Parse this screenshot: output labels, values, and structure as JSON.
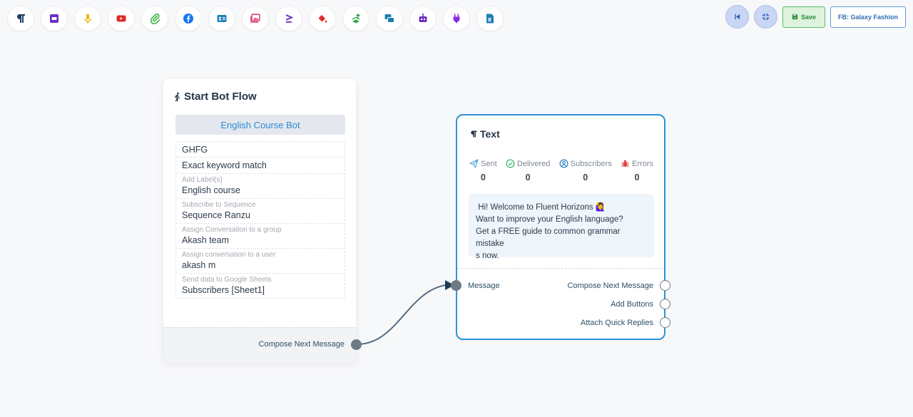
{
  "toolbar": {
    "tools": [
      {
        "icon": "paragraph-icon",
        "color": "#1f3d63"
      },
      {
        "icon": "card-icon",
        "color": "#6a2fc0"
      },
      {
        "icon": "microphone-icon",
        "color": "#f0b90b"
      },
      {
        "icon": "youtube-icon",
        "color": "#e02a2a"
      },
      {
        "icon": "paperclip-icon",
        "color": "#49b449"
      },
      {
        "icon": "facebook-icon",
        "color": "#1877f2"
      },
      {
        "icon": "contact-card-icon",
        "color": "#1b7fb5"
      },
      {
        "icon": "gallery-icon",
        "color": "#d6336c"
      },
      {
        "icon": "greater-equal-icon",
        "color": "#6a2fc0"
      },
      {
        "icon": "paint-bucket-icon",
        "color": "#e02a2a"
      },
      {
        "icon": "stack-icon",
        "color": "#2ca344"
      },
      {
        "icon": "messages-icon",
        "color": "#1b7fb5"
      },
      {
        "icon": "robot-icon",
        "color": "#6a2fc0"
      },
      {
        "icon": "plug-icon",
        "color": "#8a2be2"
      },
      {
        "icon": "excel-file-icon",
        "color": "#1b7fb5"
      }
    ],
    "save_label": "Save",
    "page_label": "FB: Galaxy Fashion"
  },
  "start_node": {
    "title": "Start Bot Flow",
    "bot_name": "English Course Bot",
    "properties": [
      {
        "label": "",
        "value": "GHFG"
      },
      {
        "label": "",
        "value": "Exact keyword match"
      },
      {
        "label": "Add Label(s)",
        "value": "English course"
      },
      {
        "label": "Subscribe to Sequence",
        "value": "Sequence Ranzu"
      },
      {
        "label": "Assign Conversation to a group",
        "value": "Akash team"
      },
      {
        "label": "Assign conversation to a user",
        "value": "akash m"
      },
      {
        "label": "Send data to Google Sheets",
        "value": "Subscribers [Sheet1]"
      }
    ],
    "output_label": "Compose Next Message"
  },
  "text_node": {
    "title": "Text",
    "stats": [
      {
        "label": "Sent",
        "value": "0",
        "icon": "send-icon",
        "color": "#4aa3df"
      },
      {
        "label": "Delivered",
        "value": "0",
        "icon": "check-circle-icon",
        "color": "#3bb56a"
      },
      {
        "label": "Subscribers",
        "value": "0",
        "icon": "user-circle-icon",
        "color": "#2b7fc1"
      },
      {
        "label": "Errors",
        "value": "0",
        "icon": "bug-icon",
        "color": "#e34545"
      }
    ],
    "message_lines": [
      " Hi! Welcome to Fluent Horizons 🙋‍♀️",
      "Want to improve your English language?",
      "Get a FREE guide to common grammar mistake",
      "s now."
    ],
    "input_label": "Message",
    "outputs": [
      "Compose Next Message",
      "Add Buttons",
      "Attach Quick Replies"
    ]
  }
}
